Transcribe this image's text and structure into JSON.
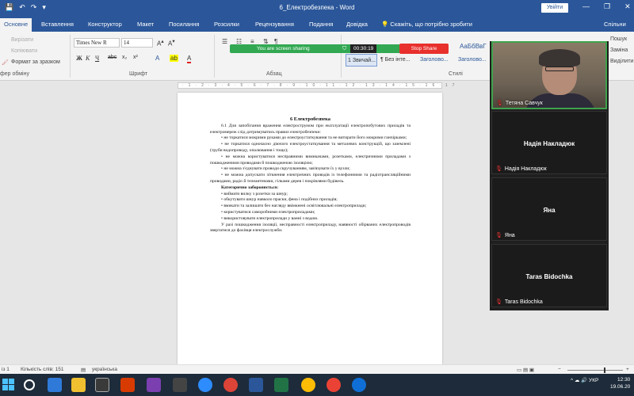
{
  "window": {
    "title": "6_Електробезпека - Word",
    "sign_in": "Увійти",
    "qat": [
      "💾",
      "↶",
      "↷",
      "▾"
    ],
    "controls": [
      "—",
      "❐",
      "✕"
    ]
  },
  "tabs": [
    {
      "label": "Основне",
      "active": true
    },
    {
      "label": "Вставлення"
    },
    {
      "label": "Конструктор"
    },
    {
      "label": "Макет"
    },
    {
      "label": "Посилання"
    },
    {
      "label": "Розсилки"
    },
    {
      "label": "Рецензування"
    },
    {
      "label": "Подання"
    },
    {
      "label": "Довідка"
    },
    {
      "label": "💡 Скажіть, що потрібно зробити"
    }
  ],
  "share_tab": "Спільни",
  "ribbon": {
    "clipboard": {
      "cut": "Вирізати",
      "copy": "Копіювати",
      "format_painter": "Формат за зразком",
      "group_label": "фер обміну"
    },
    "font": {
      "name": "Times New R",
      "size": "14",
      "group_label": "Шрифт"
    },
    "paragraph": {
      "group_label": "Абзац"
    },
    "styles": {
      "items": [
        "1 Звичай...",
        "¶ Без інте...",
        "Заголово...",
        "Заголово..."
      ],
      "top_preview": "АаБбВвГ",
      "group_label": "Стилі"
    },
    "editing": {
      "find": "Пошук",
      "replace": "Заміна",
      "select": "Виділити"
    }
  },
  "screen_share": {
    "message": "You are screen sharing",
    "timer": "00:30:19",
    "stop": "Stop Share"
  },
  "document": {
    "heading": "6 Електробезпека",
    "paragraphs": [
      {
        "text": "6.1 Для запобігання враження електрострумом при експлуатації електропобутових приладів та електромереж слід дотримуватись правил електробезпеки:",
        "indent": true,
        "bold_lead": true
      },
      {
        "text": "• не торкатися мокрими руками до електроустаткування та не витирати його мокрими ганчірками;",
        "indent": true
      },
      {
        "text": "• не торкатися одночасно діючого електроустаткування та металевих конструкцій, що заземлені (труби водопроводу, опалювання і тощо);",
        "indent": true
      },
      {
        "text": "• не можна користуватися несправними вимикачами, розетками, електричними приладами з пошкодженими проводами й пошкодженою ізоляцією;",
        "indent": true
      },
      {
        "text": "• не можна з'єднувати проводи скручуванням, зав'язувати їх у вузли;",
        "indent": true
      },
      {
        "text": "• не можна допускати зіткнення електричних проводів із телефонними та радіотрансляційними проводами, радіо й телеантенами, гілками дерев і покрівлями будівель.",
        "indent": true
      },
      {
        "text": "Категорично забороняється:",
        "indent": true
      },
      {
        "text": "• виймати вилку з розетки за шнур;",
        "indent": true
      },
      {
        "text": "• обкутувати шнур навколо праски, фена і подібних приладів;",
        "indent": true
      },
      {
        "text": "• вмикати та залишати без нагляду ввімкнені освітлювальні електроприлади;",
        "indent": true
      },
      {
        "text": "• користуватися саморобними електроприладами;",
        "indent": true
      },
      {
        "text": "• використовувати електроприлади у ванні з водою.",
        "indent": true
      },
      {
        "text": "У разі пошкодження ізоляції, несправності електроприладу, наявності обірваних електропроводів звертатися до фахівця електрослужби.",
        "indent": true
      }
    ]
  },
  "participants": {
    "camera": {
      "name": "Тетяна Савчук"
    },
    "tiles": [
      {
        "center_name": "Надія Накладюк",
        "label": "Надія Накладюк"
      },
      {
        "center_name": "Яна",
        "label": "Яна"
      },
      {
        "center_name": "Taras Bidochka",
        "label": "Taras Bidochka"
      }
    ]
  },
  "statusbar": {
    "page": "із 1",
    "words": "Кількість слів: 151",
    "language": "українська",
    "view_icons": "▭  ▤  ▣"
  },
  "taskbar": {
    "tray": "^  ☁  🔊  УКР",
    "time": "12:30",
    "date": "19.06.20"
  },
  "colors": {
    "word_blue": "#2b579a",
    "share_green": "#32a852",
    "stop_red": "#e8302c"
  }
}
